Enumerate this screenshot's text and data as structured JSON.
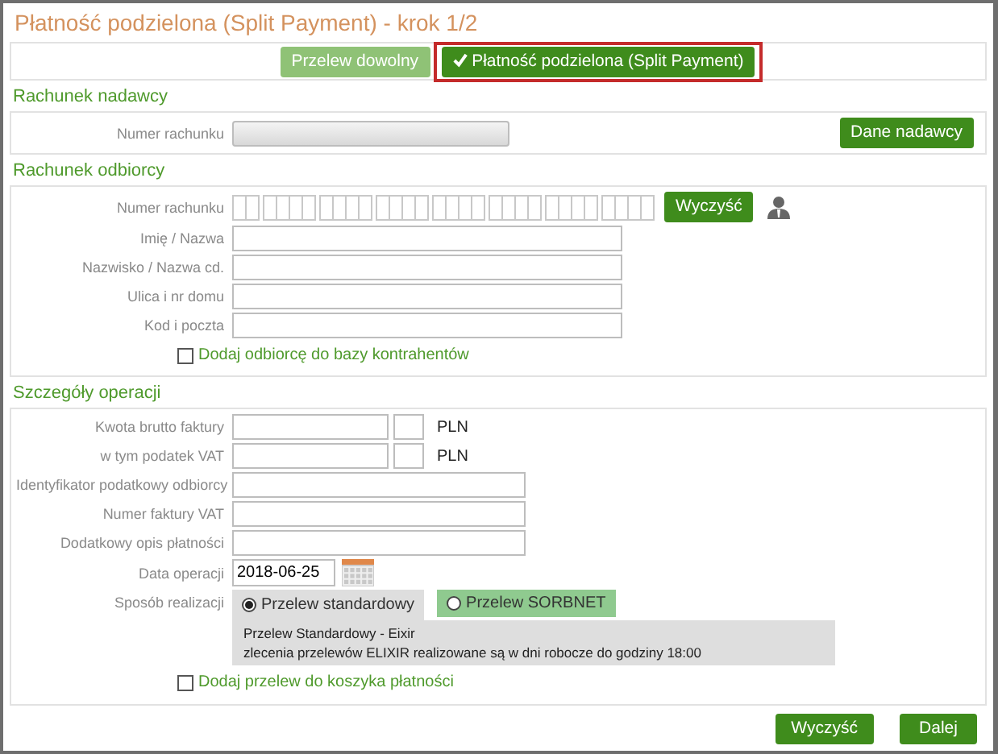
{
  "title": "Płatność podzielona (Split Payment) - krok 1/2",
  "payment_tabs": [
    {
      "label": "Przelew dowolny",
      "selected": false,
      "highlighted": false
    },
    {
      "label": "Płatność podzielona (Split Payment)",
      "selected": true,
      "highlighted": true
    }
  ],
  "sender": {
    "heading": "Rachunek nadawcy",
    "account_label": "Numer rachunku",
    "details_button": "Dane nadawcy"
  },
  "recipient": {
    "heading": "Rachunek odbiorcy",
    "account_label": "Numer rachunku",
    "clear_button": "Wyczyść",
    "fields": [
      {
        "label": "Imię / Nazwa"
      },
      {
        "label": "Nazwisko / Nazwa cd."
      },
      {
        "label": "Ulica i nr domu"
      },
      {
        "label": "Kod i poczta"
      }
    ],
    "checkbox": {
      "label": "Dodaj odbiorcę do bazy kontrahentów",
      "checked": false
    }
  },
  "details": {
    "heading": "Szczegóły operacji",
    "rows": [
      {
        "kind": "amount",
        "label": "Kwota brutto faktury",
        "currency": "PLN"
      },
      {
        "kind": "amount",
        "label": "w tym podatek VAT",
        "currency": "PLN"
      },
      {
        "kind": "text",
        "label": "Identyfikator podatkowy odbiorcy"
      },
      {
        "kind": "text",
        "label": "Numer faktury VAT"
      },
      {
        "kind": "text",
        "label": "Dodatkowy opis płatności"
      },
      {
        "kind": "date",
        "label": "Data operacji",
        "value": "2018-06-25"
      }
    ],
    "mode_label": "Sposób realizacji",
    "modes": [
      {
        "label": "Przelew standardowy",
        "selected": true
      },
      {
        "label": "Przelew SORBNET",
        "selected": false
      }
    ],
    "mode_info": [
      "Przelew Standardowy - Eixir",
      "zlecenia przelewów ELIXIR realizowane są w dni robocze do godziny 18:00"
    ],
    "checkbox": {
      "label": "Dodaj przelew do koszyka płatności",
      "checked": false
    }
  },
  "buttons": [
    {
      "label": "Wyczyść"
    },
    {
      "label": "Dalej"
    }
  ]
}
